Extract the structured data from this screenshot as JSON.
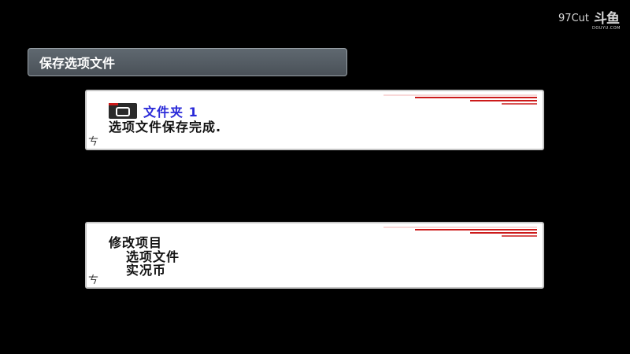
{
  "watermark": {
    "text": "97Cut",
    "logo": "斗鱼",
    "logo_sub": "DOUYU.COM"
  },
  "title_bar": {
    "title": "保存选项文件"
  },
  "save_panel": {
    "slot_label": "文件夹 1",
    "message": "选项文件保存完成.",
    "corner_glyph": "ㄘ",
    "icon": "memory-card-icon"
  },
  "edit_panel": {
    "heading": "修改项目",
    "items": [
      "选项文件",
      "实况币"
    ],
    "corner_glyph": "ㄘ"
  },
  "colors": {
    "background": "#000000",
    "title_bar": "#555d64",
    "slot_label": "#2a2ad8",
    "accent_red": "#cc1a1a"
  }
}
